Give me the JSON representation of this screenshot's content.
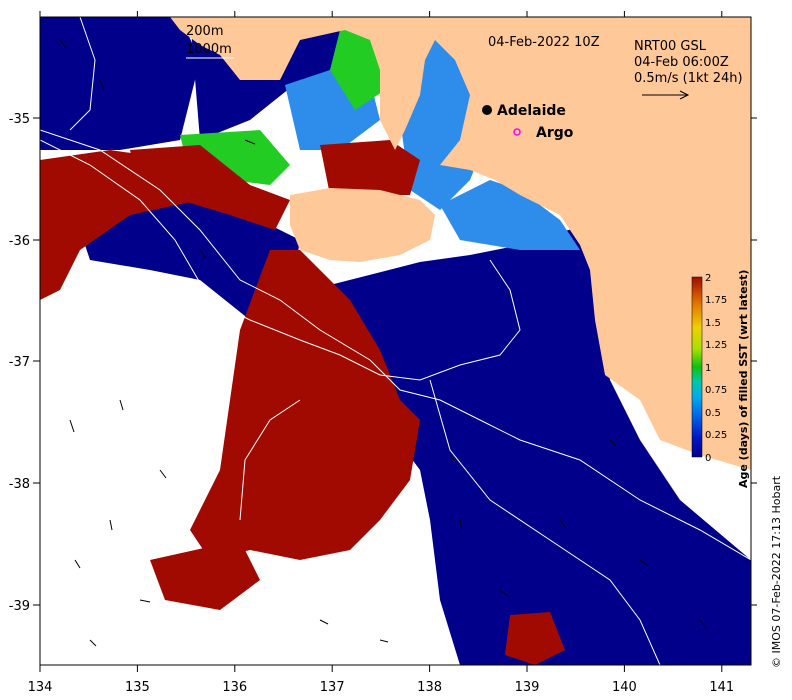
{
  "map": {
    "x_ticks": [
      "134",
      "135",
      "136",
      "137",
      "138",
      "139",
      "140",
      "141"
    ],
    "y_ticks": [
      "-35",
      "-36",
      "-37",
      "-38",
      "-39"
    ],
    "lon_range": [
      134,
      141.3
    ],
    "lat_range": [
      -39.5,
      -34.2
    ],
    "date_label": "04-Feb-2022 10Z",
    "product_lines": [
      "NRT00 GSL",
      "04-Feb 06:00Z",
      "0.5m/s (1kt 24h)"
    ],
    "isobath_legend": [
      "200m",
      "1000m"
    ],
    "places": [
      {
        "name": "Adelaide",
        "marker": "filled-black-circle"
      },
      {
        "name": "Argo",
        "marker": "magenta-open-circle"
      }
    ],
    "credit": "© IMOS 07-Feb-2022 17:13 Hobart",
    "colors": {
      "land": "#FFC898",
      "age_0": "#00008B",
      "age_2": "#A10A00",
      "green": "#22CC22",
      "light_blue": "#2E8CEB"
    }
  },
  "colorbar": {
    "title": "Age (days) of filled SST (wrt latest)",
    "labels": [
      "2",
      "1.75",
      "1.5",
      "1.25",
      "1",
      "0.75",
      "0.5",
      "0.25",
      "0"
    ],
    "stops": [
      "#00008B",
      "#0018C8",
      "#0060E8",
      "#00A8F0",
      "#00C8A8",
      "#10C010",
      "#A8E000",
      "#F0D000",
      "#E07000",
      "#A10A00"
    ]
  }
}
